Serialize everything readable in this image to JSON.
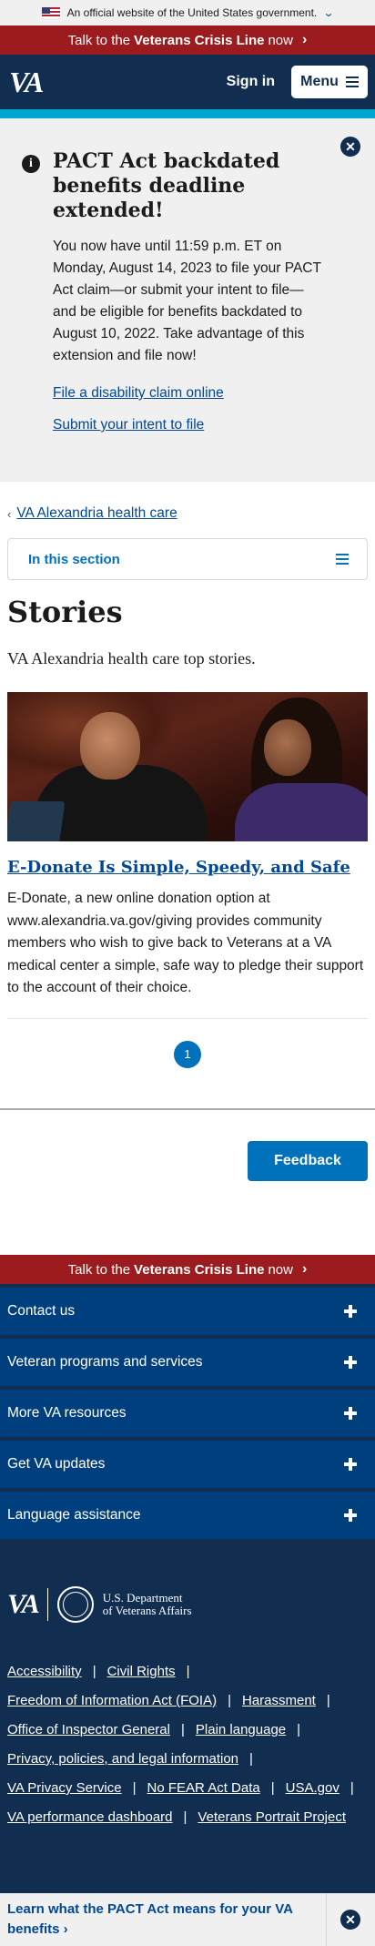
{
  "gov_banner": {
    "text": "An official website of the United States government."
  },
  "crisis_line": {
    "prefix": "Talk to the",
    "bold": "Veterans Crisis Line",
    "suffix": "now"
  },
  "header": {
    "logo": "VA",
    "sign_in": "Sign in",
    "menu": "Menu"
  },
  "alert": {
    "title": "PACT Act backdated benefits deadline extended!",
    "body": "You now have until 11:59 p.m. ET on Monday, August 14, 2023 to file your PACT Act claim—or submit your intent to file—and be eligible for benefits backdated to August 10, 2022. Take advantage of this extension and file now!",
    "link1": "File a disability claim online",
    "link2": "Submit your intent to file"
  },
  "breadcrumb": {
    "label": "VA Alexandria health care"
  },
  "section_nav": {
    "label": "In this section"
  },
  "page": {
    "title": "Stories",
    "intro": "VA Alexandria health care top stories."
  },
  "story": {
    "title": "E-Donate Is Simple, Speedy, and Safe",
    "description": "E-Donate, a new online donation option at www.alexandria.va.gov/giving provides community members who wish to give back to Veterans at a VA medical center a simple, safe way to pledge their support to the account of their choice."
  },
  "pagination": {
    "current": "1"
  },
  "feedback": {
    "label": "Feedback"
  },
  "footer": {
    "accordions": [
      "Contact us",
      "Veteran programs and services",
      "More VA resources",
      "Get VA updates",
      "Language assistance"
    ],
    "department_line1": "U.S. Department",
    "department_line2": "of Veterans Affairs",
    "links": {
      "accessibility": "Accessibility",
      "civil_rights": "Civil Rights",
      "foia": "Freedom of Information Act (FOIA)",
      "harassment": "Harassment",
      "oig": "Office of Inspector General",
      "plain_language": "Plain language",
      "privacy": "Privacy, policies, and legal information",
      "privacy_service": "VA Privacy Service",
      "no_fear": "No FEAR Act Data",
      "usa_gov": "USA.gov",
      "performance": "VA performance dashboard",
      "portrait": "Veterans Portrait Project"
    }
  },
  "pact_banner": {
    "text": "Learn what the PACT Act means for your VA benefits"
  }
}
